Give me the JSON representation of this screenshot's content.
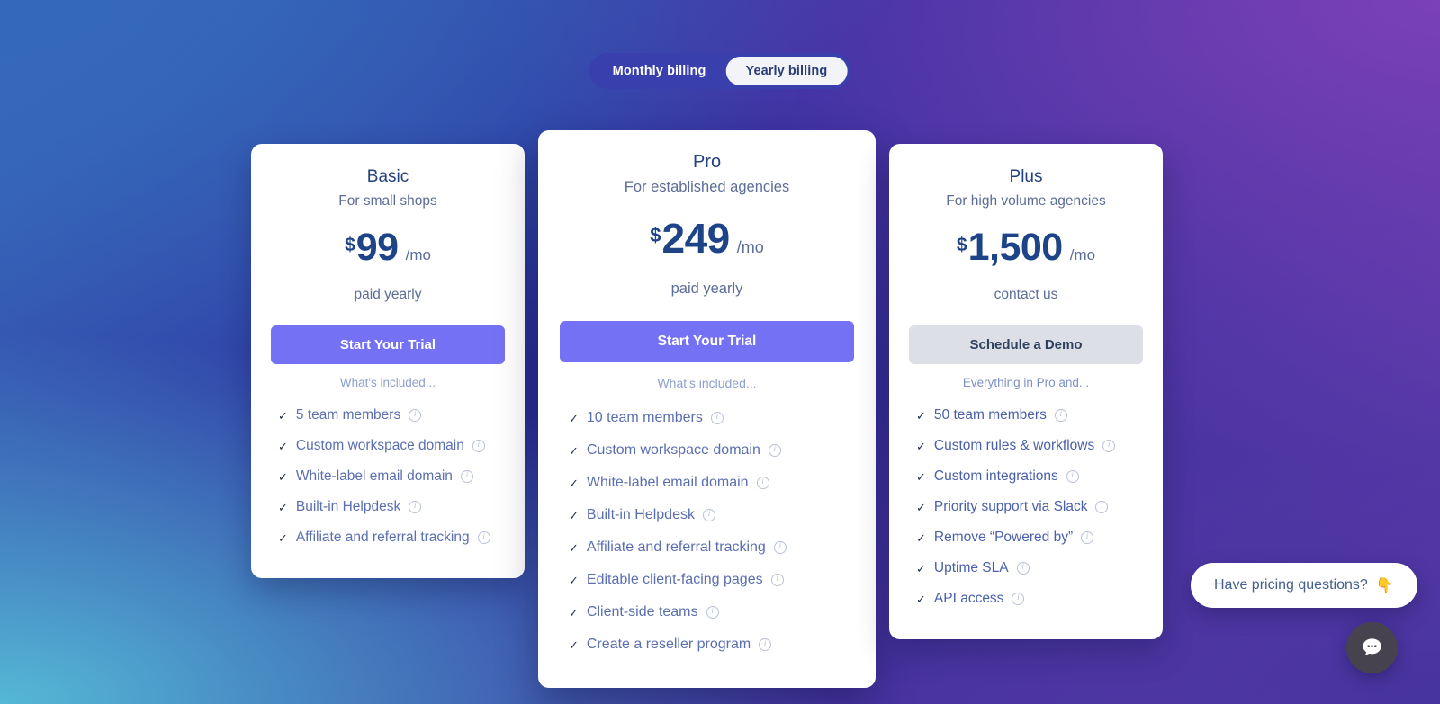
{
  "billing_toggle": {
    "options": [
      {
        "label": "Monthly billing",
        "active": false
      },
      {
        "label": "Yearly billing",
        "active": true
      }
    ]
  },
  "plans": [
    {
      "name": "Basic",
      "tagline": "For small shops",
      "currency": "$",
      "amount": "99",
      "period": "/mo",
      "billing_note": "paid yearly",
      "cta_label": "Start Your Trial",
      "cta_style": "primary",
      "features_header": "What's included...",
      "features": [
        "5 team members",
        "Custom workspace domain",
        "White-label email domain",
        "Built-in Helpdesk",
        "Affiliate and referral tracking"
      ]
    },
    {
      "name": "Pro",
      "tagline": "For established agencies",
      "currency": "$",
      "amount": "249",
      "period": "/mo",
      "billing_note": "paid yearly",
      "cta_label": "Start Your Trial",
      "cta_style": "primary",
      "features_header": "What's included...",
      "features": [
        "10 team members",
        "Custom workspace domain",
        "White-label email domain",
        "Built-in Helpdesk",
        "Affiliate and referral tracking",
        "Editable client-facing pages",
        "Client-side teams",
        "Create a reseller program"
      ]
    },
    {
      "name": "Plus",
      "tagline": "For high volume agencies",
      "currency": "$",
      "amount": "1,500",
      "period": "/mo",
      "billing_note": "contact us",
      "cta_label": "Schedule a Demo",
      "cta_style": "muted",
      "features_header": "Everything in Pro and...",
      "features": [
        "50 team members",
        "Custom rules & workflows",
        "Custom integrations",
        "Priority support via Slack",
        "Remove “Powered by”",
        "Uptime SLA",
        "API access"
      ]
    }
  ],
  "chat": {
    "bubble_text": "Have pricing questions?",
    "bubble_emoji": "👇",
    "launcher_icon": "chat-bubble-icon"
  },
  "icons": {
    "check": "✓",
    "info": "i"
  },
  "colors": {
    "cta_primary": "#7471f5",
    "cta_muted": "#dcdfe6",
    "price_text": "#1d4487",
    "plan_name": "#23417e",
    "feature_text": "#5b6fb0",
    "toggle_track": "#3a3fae",
    "toggle_active_bg": "#f2f4f8",
    "chat_launcher_bg": "#46434f"
  }
}
